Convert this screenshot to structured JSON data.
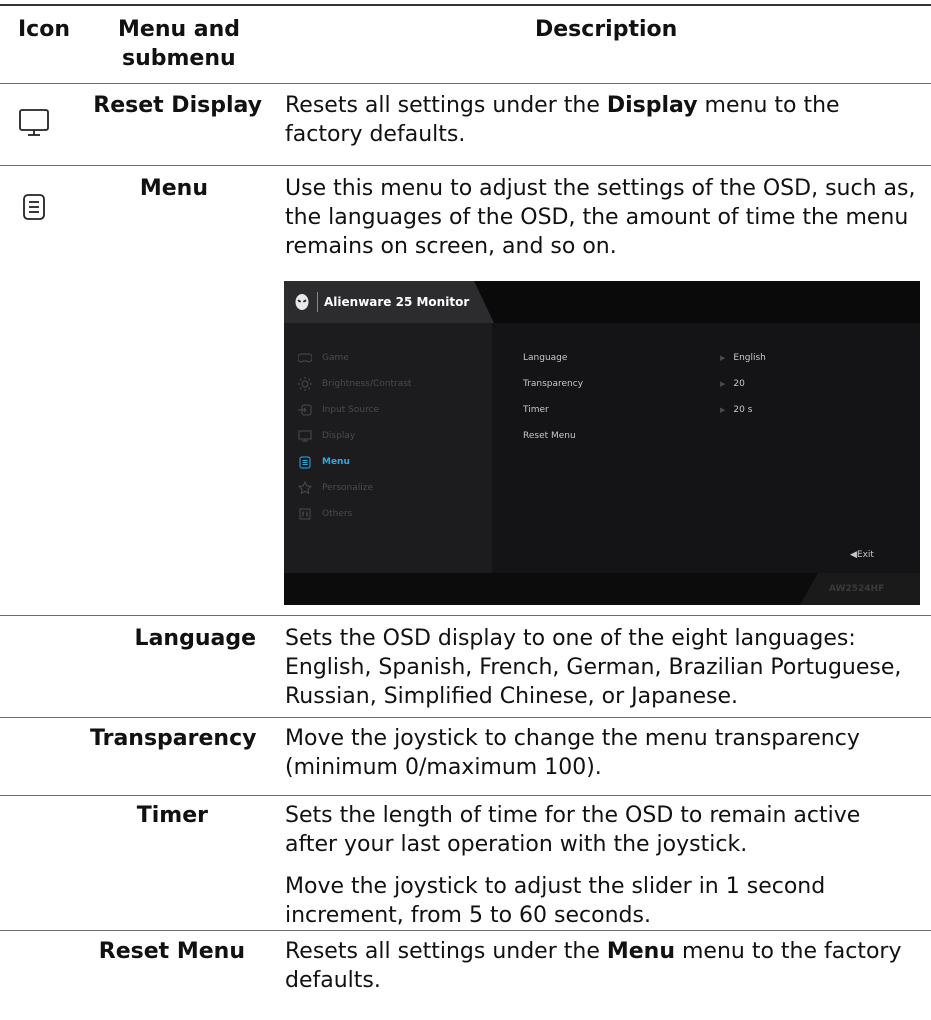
{
  "header": {
    "icon_col": "Icon",
    "menu_col_line1": "Menu and",
    "menu_col_line2": "submenu",
    "desc_col": "Description"
  },
  "rows": {
    "reset_display": {
      "icon": "monitor-icon",
      "label": "Reset Display",
      "desc_a": "Resets all settings under the ",
      "desc_bold": "Display",
      "desc_b": " menu to the",
      "desc_c": "factory defaults."
    },
    "menu": {
      "icon": "menu-list-icon",
      "label": "Menu",
      "desc_1": "Use this menu to adjust the settings of the OSD, such as,",
      "desc_2": "the languages of the OSD, the amount of time the menu",
      "desc_3": "remains on screen, and so on."
    },
    "language": {
      "label": "Language",
      "desc_1": "Sets the OSD display to one of the eight languages:",
      "desc_2": "English, Spanish, French, German, Brazilian Portuguese,",
      "desc_3": "Russian, Simplified Chinese, or Japanese."
    },
    "transparency": {
      "label": "Transparency",
      "desc_1": "Move the joystick to change the menu transparency",
      "desc_2": "(minimum 0/maximum 100)."
    },
    "timer": {
      "label": "Timer",
      "desc_1": "Sets the length of time for the OSD to remain active",
      "desc_2": "after your last operation with the joystick.",
      "desc_3": "Move the joystick to adjust the slider in 1 second",
      "desc_4": "increment, from 5 to 60 seconds."
    },
    "reset_menu": {
      "label": "Reset Menu",
      "desc_a": "Resets all settings under the ",
      "desc_bold": "Menu",
      "desc_b": " menu to the factory",
      "desc_c": "defaults."
    }
  },
  "osd": {
    "title": "Alienware 25 Monitor",
    "model": "AW2524HF",
    "exit": "◀Exit",
    "accent": "#2fa8e8",
    "nav": [
      {
        "label": "Game",
        "icon": "gamepad-icon"
      },
      {
        "label": "Brightness/Contrast",
        "icon": "brightness-icon"
      },
      {
        "label": "Input Source",
        "icon": "input-source-icon"
      },
      {
        "label": "Display",
        "icon": "display-icon"
      },
      {
        "label": "Menu",
        "icon": "menu-icon"
      },
      {
        "label": "Personalize",
        "icon": "star-icon"
      },
      {
        "label": "Others",
        "icon": "others-icon"
      }
    ],
    "settings": [
      {
        "label": "Language",
        "value": "English"
      },
      {
        "label": "Transparency",
        "value": "20"
      },
      {
        "label": "Timer",
        "value": "20 s"
      },
      {
        "label": "Reset Menu",
        "value": ""
      }
    ]
  }
}
